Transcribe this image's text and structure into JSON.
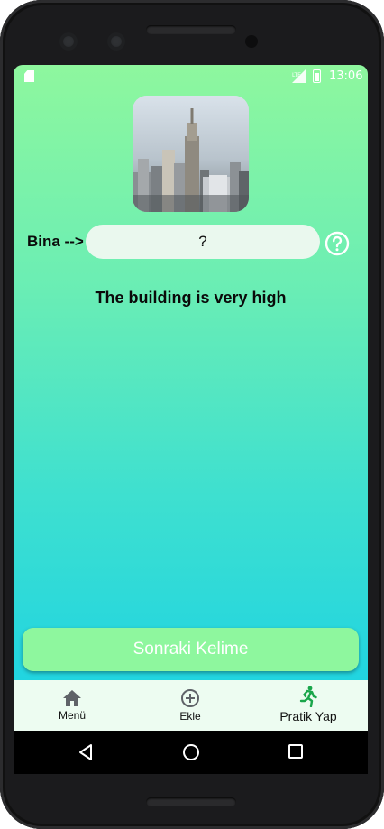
{
  "status_bar": {
    "time": "13:06",
    "network": "LTE",
    "icons": [
      "sd-card-icon",
      "signal-icon",
      "battery-icon"
    ]
  },
  "quiz": {
    "image_icon": "city-skyline-photo",
    "word_label": "Bina -->",
    "answer_value": "?",
    "help_icon": "question-circle-icon",
    "sentence": "The building is very high"
  },
  "next_button": {
    "label": "Sonraki Kelime"
  },
  "bottom_nav": {
    "items": [
      {
        "label": "Menü",
        "icon": "home-icon"
      },
      {
        "label": "Ekle",
        "icon": "add-circle-icon"
      },
      {
        "label": "Pratik Yap",
        "icon": "running-icon",
        "active": true
      }
    ]
  },
  "system_nav": {
    "icons": [
      "back-icon",
      "home-circle-icon",
      "recents-icon"
    ]
  },
  "colors": {
    "gradient_top": "#8ef79e",
    "gradient_bottom": "#12cfe9",
    "button": "#8ef79e",
    "nav_bg": "#edfcf1",
    "active_nav": "#1aa64b"
  }
}
